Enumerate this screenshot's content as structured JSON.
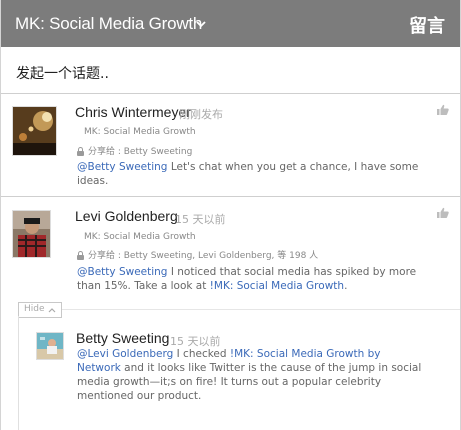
{
  "header": {
    "title": "MK: Social Media Growth",
    "comment_label": "留言"
  },
  "compose": {
    "placeholder": "发起一个话题.."
  },
  "posts": [
    {
      "author": "Chris Wintermeyer",
      "time": "刚刚发布",
      "group": "MK: Social Media Growth",
      "shared": "分享给 : Betty Sweeting",
      "mention": "@Betty Sweeting",
      "text": " Let's chat when you get a chance, I have some ideas."
    },
    {
      "author": "Levi Goldenberg",
      "time": "15 天以前",
      "group": "MK: Social Media Growth",
      "shared": "分享给 : Betty Sweeting,  Levi Goldenberg,  等 198 人",
      "mention": "@Betty Sweeting",
      "text": " I noticed that social media has spiked by more than 15%. Take a look at ",
      "link": "!MK: Social Media Growth",
      "text_end": ".",
      "hide_label": "Hide",
      "reply": {
        "author": "Betty Sweeting",
        "time": "15 天以前",
        "mention": "@Levi Goldenberg",
        "text1": " I checked ",
        "link": "!MK: Social Media Growth by Network",
        "text2": " and it looks like Twitter is the cause of the jump in social media growth—it;s on fire! It turns out a popular celebrity mentioned our product."
      }
    }
  ],
  "colors": {
    "header_bg": "#7c7c7c",
    "mention": "#3a69b8",
    "divider": "#cfcfcf"
  },
  "icons": [
    "chevron-down-icon",
    "lock-icon",
    "thumbs-up-icon",
    "chevron-up-icon"
  ]
}
